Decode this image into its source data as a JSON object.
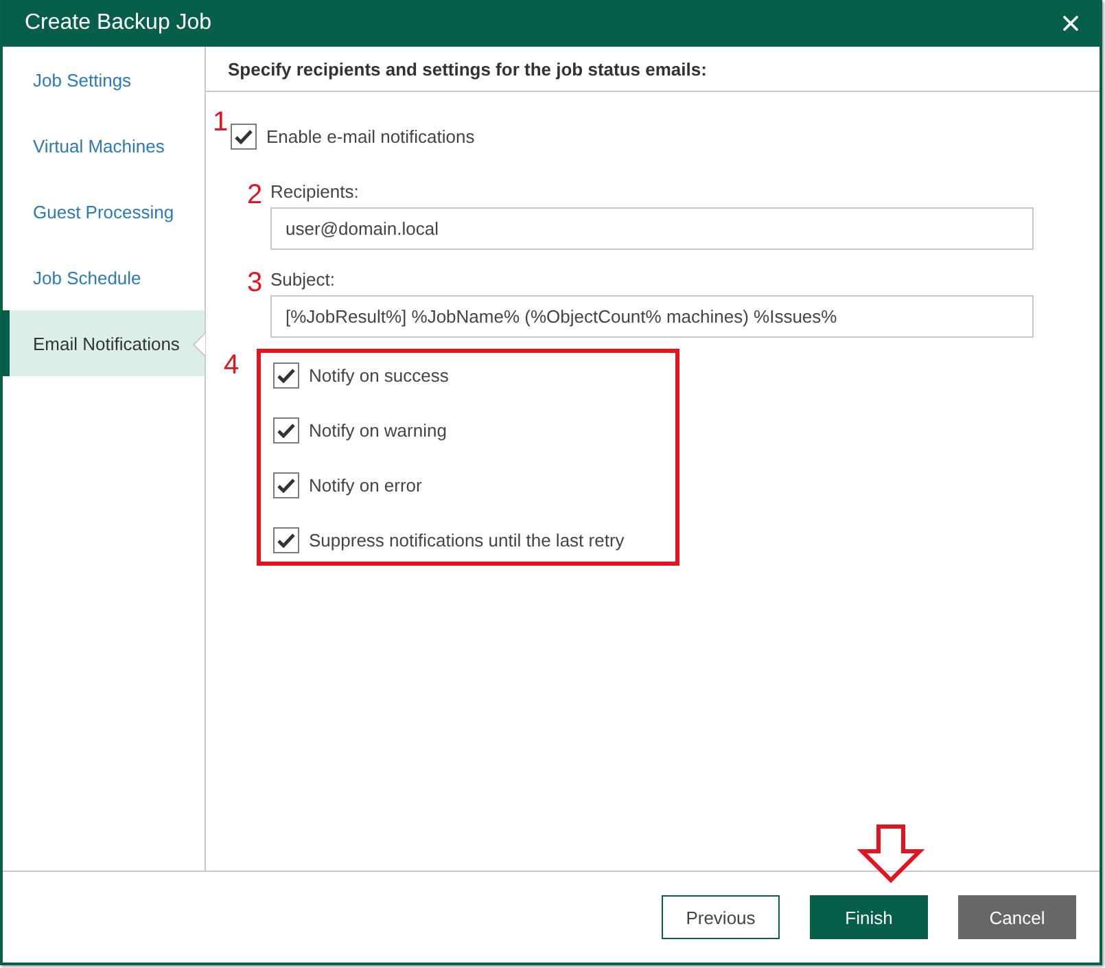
{
  "window": {
    "title": "Create Backup Job"
  },
  "sidebar": {
    "items": [
      {
        "label": "Job Settings",
        "selected": false
      },
      {
        "label": "Virtual Machines",
        "selected": false
      },
      {
        "label": "Guest Processing",
        "selected": false
      },
      {
        "label": "Job Schedule",
        "selected": false
      },
      {
        "label": "Email Notifications",
        "selected": true
      }
    ]
  },
  "header": "Specify recipients and settings for the job status emails:",
  "enable": {
    "marker": "1",
    "label": "Enable e-mail notifications",
    "checked": true
  },
  "recipients": {
    "marker": "2",
    "label": "Recipients:",
    "value": "user@domain.local"
  },
  "subject": {
    "marker": "3",
    "label": "Subject:",
    "value": "[%JobResult%] %JobName% (%ObjectCount% machines) %Issues%"
  },
  "options": {
    "marker": "4",
    "items": [
      {
        "label": "Notify on success",
        "checked": true
      },
      {
        "label": "Notify on warning",
        "checked": true
      },
      {
        "label": "Notify on error",
        "checked": true
      },
      {
        "label": "Suppress notifications until the last retry",
        "checked": true
      }
    ]
  },
  "buttons": [
    {
      "label": "Previous",
      "kind": "secondary"
    },
    {
      "label": "Finish",
      "kind": "primary"
    },
    {
      "label": "Cancel",
      "kind": "cancel"
    }
  ]
}
